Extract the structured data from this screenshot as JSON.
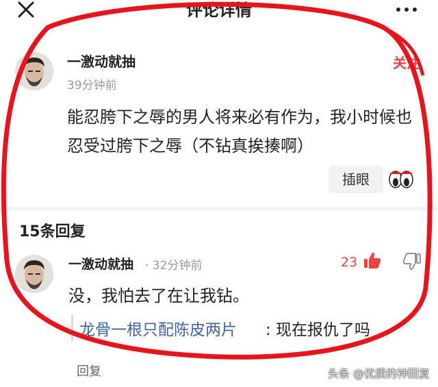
{
  "header": {
    "title": "评论详情"
  },
  "main_comment": {
    "username": "一激动就抽",
    "time": "39分钟前",
    "follow_label": "关注",
    "content": "能忍胯下之辱的男人将来必有作为，我小时候也忍受过胯下之辱（不钻真挨揍啊）",
    "chip_label": "插眼"
  },
  "replies": {
    "header": "15条回复",
    "items": [
      {
        "username": "一激动就抽",
        "time": "· 32分钟前",
        "likes": "23",
        "content": "没，我怕去了在让我钻。",
        "quote_user": "龙骨一根只配陈皮两片",
        "quote_text": ": 现在报仇了吗",
        "reply_label": "回复"
      }
    ]
  },
  "watermark": "头条 @优质的神回复",
  "colors": {
    "accent": "#f04142",
    "link": "#406599",
    "annotation": "#e8141c"
  }
}
